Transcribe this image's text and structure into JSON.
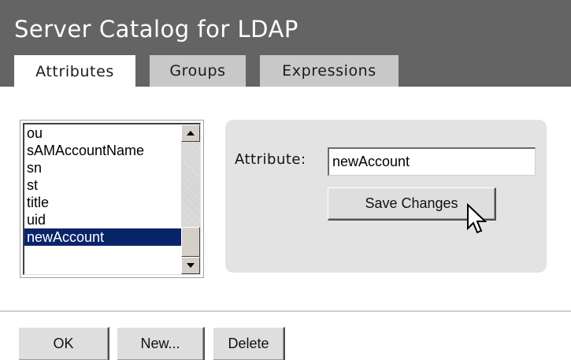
{
  "header": {
    "title": "Server Catalog for LDAP",
    "tabs": [
      {
        "label": "Attributes",
        "active": true
      },
      {
        "label": "Groups",
        "active": false
      },
      {
        "label": "Expressions",
        "active": false
      }
    ]
  },
  "attribute_list": {
    "items": [
      "ou",
      "sAMAccountName",
      "sn",
      "st",
      "title",
      "uid",
      "newAccount"
    ],
    "selected": "newAccount"
  },
  "editor": {
    "attribute_label": "Attribute:",
    "attribute_value": "newAccount",
    "save_label": "Save Changes"
  },
  "footer": {
    "ok_label": "OK",
    "new_label": "New...",
    "delete_label": "Delete"
  },
  "colors": {
    "header_bg": "#646464",
    "selection_bg": "#0a246a",
    "panel_bg": "#e3e3e3"
  },
  "icons": [
    "scroll-up-arrow-icon",
    "scroll-down-arrow-icon",
    "mouse-pointer-icon"
  ]
}
